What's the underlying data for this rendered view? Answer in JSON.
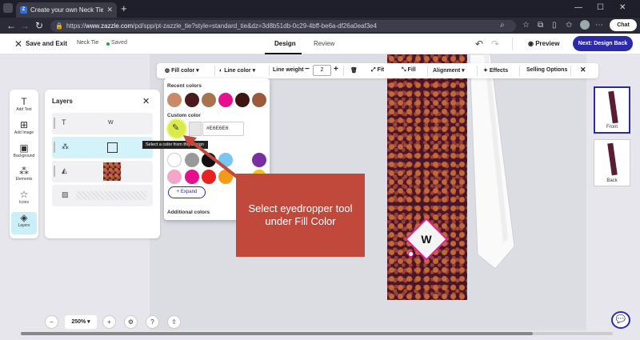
{
  "browser": {
    "tab_title": "Create your own Neck Tie | Zazzle",
    "tab_favicon": "Z",
    "url_prefix": "https://",
    "url_host": "www.zazzle.com",
    "url_path": "/pd/spp/pt-zazzle_tie?style=standard_tie&dz=3d8b51db-0c29-4bff-be6a-df26a0eaf3e4",
    "chat_label": "Chat"
  },
  "header": {
    "save_exit": "Save and Exit",
    "product": "Neck Tie",
    "status": "Saved",
    "tabs": [
      "Design",
      "Review"
    ],
    "preview": "Preview",
    "next": "Next: Design Back"
  },
  "rail": {
    "items": [
      {
        "label": "Add Text",
        "icon": "text-icon"
      },
      {
        "label": "Add Image",
        "icon": "image-icon"
      },
      {
        "label": "Background",
        "icon": "background-icon"
      },
      {
        "label": "Elements",
        "icon": "elements-icon"
      },
      {
        "label": "Icons",
        "icon": "star-icon"
      },
      {
        "label": "Layers",
        "icon": "layers-icon"
      }
    ]
  },
  "layers": {
    "title": "Layers",
    "rows": [
      {
        "label": "W"
      }
    ]
  },
  "toolbar": {
    "fill_color": "Fill color",
    "line_color": "Line color",
    "line_weight_label": "Line weight",
    "line_weight_value": "2",
    "fit": "Fit",
    "fill": "Fill",
    "alignment": "Alignment",
    "effects": "Effects",
    "selling_options": "Selling Options"
  },
  "fill_panel": {
    "recent_title": "Recent colors",
    "recent_colors": [
      "#c98b67",
      "#4a1a1f",
      "#a8734f",
      "#e5118c",
      "#3c1612",
      "#9a5b3c"
    ],
    "custom_title": "Custom color",
    "hex_value": "#E6E6E6",
    "tooltip": "Select a color from the design",
    "palette_row1": [
      "#ffffff",
      "#999999",
      "#111111",
      "#7ac6f2",
      "#7a2ea0"
    ],
    "palette_row2": [
      "#f4a6c9",
      "#e5118c",
      "#e62222",
      "#f39a1b",
      "#f2c21b"
    ],
    "expand": "+ Expand",
    "additional_title": "Additional colors"
  },
  "monogram": "W",
  "callout": {
    "line1": "Select eyedropper tool",
    "line2": "under Fill Color"
  },
  "views": [
    {
      "label": "Front"
    },
    {
      "label": "Back"
    }
  ],
  "zoom": "250%",
  "colors": {
    "accent": "#2b2aa8",
    "selection": "#e11c8f",
    "callout": "#c0493b",
    "tie": "#4a1528"
  }
}
